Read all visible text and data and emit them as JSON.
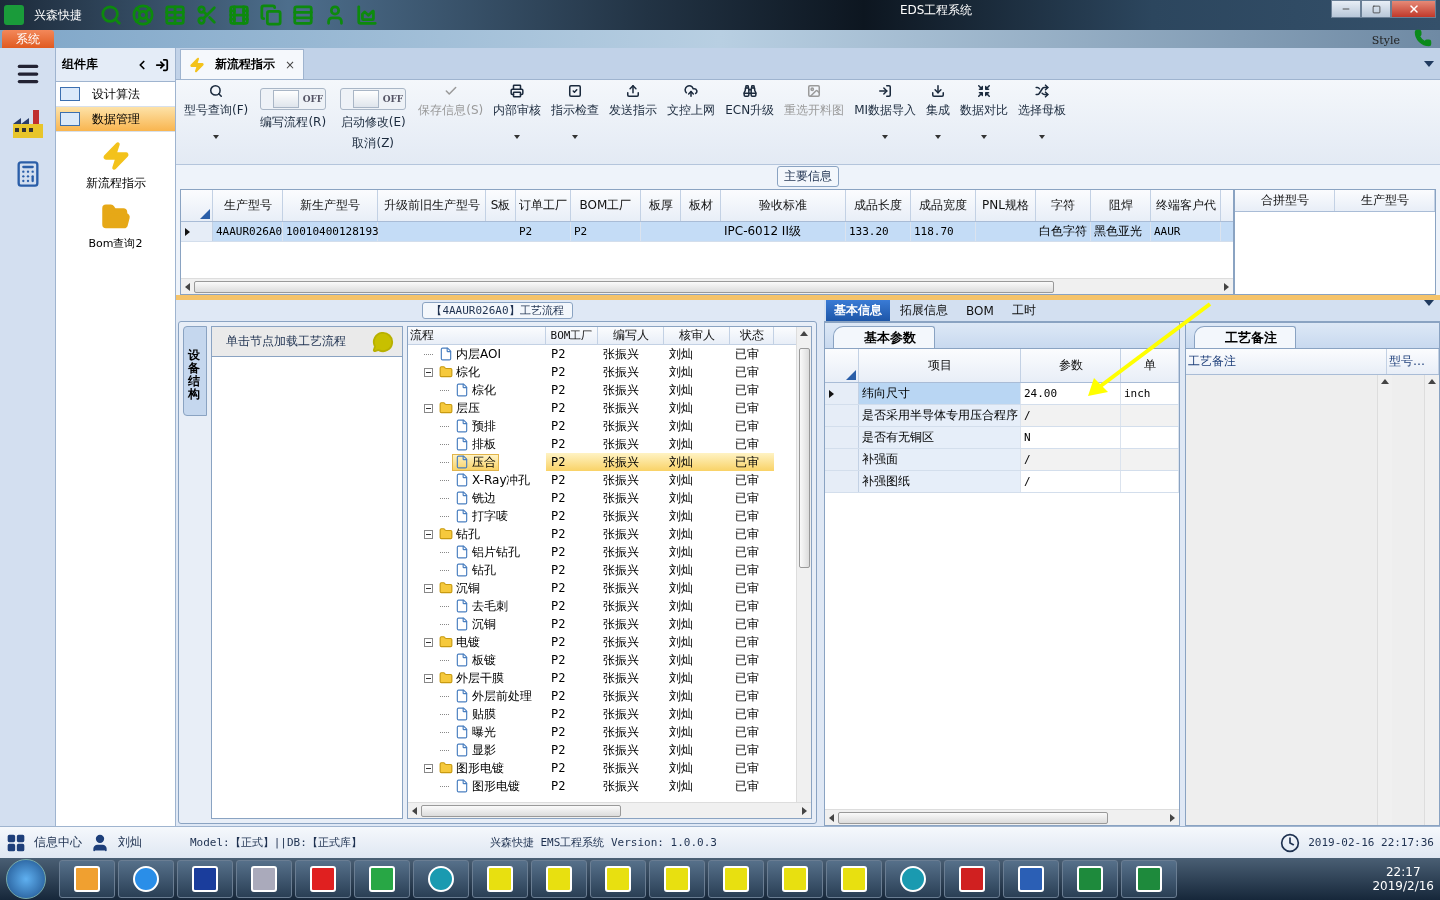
{
  "window": {
    "title": "EDS工程系统",
    "app_name": "兴森快捷"
  },
  "ribbon": {
    "tab": "系统",
    "style_menu": "Style"
  },
  "sidebar": {
    "title": "组件库",
    "items": [
      {
        "label": "设计算法",
        "selected": false
      },
      {
        "label": "数据管理",
        "selected": true
      }
    ],
    "tiles": [
      {
        "label": "新流程指示"
      },
      {
        "label": "Bom查询2"
      }
    ]
  },
  "document_tab": {
    "label": "新流程指示",
    "close": "×"
  },
  "toolbar": [
    {
      "kind": "button",
      "label": "型号查询(F)",
      "disabled": false,
      "dropdown": true
    },
    {
      "kind": "toggle",
      "label": "编写流程(R)",
      "on": false,
      "state_text": "OFF"
    },
    {
      "kind": "toggle",
      "label": "启动修改(E)",
      "sublabel": "取消(Z)",
      "on": false,
      "state_text": "OFF"
    },
    {
      "kind": "button",
      "label": "保存信息(S)",
      "disabled": true,
      "dropdown": false
    },
    {
      "kind": "button",
      "label": "内部审核",
      "disabled": false,
      "dropdown": true
    },
    {
      "kind": "button",
      "label": "指示检查",
      "disabled": false,
      "dropdown": true
    },
    {
      "kind": "button",
      "label": "发送指示",
      "disabled": false,
      "dropdown": false
    },
    {
      "kind": "button",
      "label": "文控上网",
      "disabled": false,
      "dropdown": false
    },
    {
      "kind": "button",
      "label": "ECN升级",
      "disabled": false,
      "dropdown": false
    },
    {
      "kind": "button",
      "label": "重选开料图",
      "disabled": true,
      "dropdown": false
    },
    {
      "kind": "button",
      "label": "MI数据导入",
      "disabled": false,
      "dropdown": true
    },
    {
      "kind": "button",
      "label": "集成",
      "disabled": false,
      "dropdown": true
    },
    {
      "kind": "button",
      "label": "数据对比",
      "disabled": false,
      "dropdown": true
    },
    {
      "kind": "button",
      "label": "选择母板",
      "disabled": false,
      "dropdown": true
    }
  ],
  "main_info": {
    "title": "主要信息",
    "columns": [
      "生产型号",
      "新生产型号",
      "升级前旧生产型号",
      "S板",
      "订单工厂",
      "BOM工厂",
      "板厚",
      "板材",
      "验收标准",
      "成品长度",
      "成品宽度",
      "PNL规格",
      "字符",
      "阻焊",
      "终端客户代"
    ],
    "rows": [
      {
        "selected": true,
        "cells": [
          "4AAUR026A0",
          "10010400128193",
          null,
          null,
          "P2",
          "P2",
          null,
          null,
          "IPC-6012 II级",
          "133.20",
          "118.70",
          null,
          "白色字符",
          "黑色亚光",
          "AAUR"
        ]
      }
    ],
    "side_columns": [
      "合拼型号",
      "生产型号"
    ]
  },
  "process": {
    "title": "【4AAUR026A0】工艺流程",
    "side_tab": "设备结构",
    "hint": "单击节点加载工艺流程",
    "columns": [
      "流程",
      "BOM工厂",
      "编写人",
      "核审人",
      "状态"
    ],
    "tree": [
      {
        "label": "内层AOI",
        "kind": "file",
        "selected": false,
        "bom": "P2",
        "writer": "张振兴",
        "reviewer": "刘灿",
        "status": "已审"
      },
      {
        "label": "棕化",
        "kind": "folder",
        "expanded": true,
        "selected": false,
        "bom": "P2",
        "writer": "张振兴",
        "reviewer": "刘灿",
        "status": "已审",
        "children": [
          {
            "label": "棕化",
            "kind": "file",
            "selected": false,
            "bom": "P2",
            "writer": "张振兴",
            "reviewer": "刘灿",
            "status": "已审"
          }
        ]
      },
      {
        "label": "层压",
        "kind": "folder",
        "expanded": true,
        "selected": false,
        "bom": "P2",
        "writer": "张振兴",
        "reviewer": "刘灿",
        "status": "已审",
        "children": [
          {
            "label": "预排",
            "kind": "file",
            "selected": false,
            "bom": "P2",
            "writer": "张振兴",
            "reviewer": "刘灿",
            "status": "已审"
          },
          {
            "label": "排板",
            "kind": "file",
            "selected": false,
            "bom": "P2",
            "writer": "张振兴",
            "reviewer": "刘灿",
            "status": "已审"
          },
          {
            "label": "压合",
            "kind": "file",
            "selected": true,
            "bom": "P2",
            "writer": "张振兴",
            "reviewer": "刘灿",
            "status": "已审"
          },
          {
            "label": "X-Ray冲孔",
            "kind": "file",
            "selected": false,
            "bom": "P2",
            "writer": "张振兴",
            "reviewer": "刘灿",
            "status": "已审"
          },
          {
            "label": "铣边",
            "kind": "file",
            "selected": false,
            "bom": "P2",
            "writer": "张振兴",
            "reviewer": "刘灿",
            "status": "已审"
          },
          {
            "label": "打字唛",
            "kind": "file",
            "selected": false,
            "bom": "P2",
            "writer": "张振兴",
            "reviewer": "刘灿",
            "status": "已审"
          }
        ]
      },
      {
        "label": "钻孔",
        "kind": "folder",
        "expanded": true,
        "selected": false,
        "bom": "P2",
        "writer": "张振兴",
        "reviewer": "刘灿",
        "status": "已审",
        "children": [
          {
            "label": "铝片钻孔",
            "kind": "file",
            "selected": false,
            "bom": "P2",
            "writer": "张振兴",
            "reviewer": "刘灿",
            "status": "已审"
          },
          {
            "label": "钻孔",
            "kind": "file",
            "selected": false,
            "bom": "P2",
            "writer": "张振兴",
            "reviewer": "刘灿",
            "status": "已审"
          }
        ]
      },
      {
        "label": "沉铜",
        "kind": "folder",
        "expanded": true,
        "selected": false,
        "bom": "P2",
        "writer": "张振兴",
        "reviewer": "刘灿",
        "status": "已审",
        "children": [
          {
            "label": "去毛刺",
            "kind": "file",
            "selected": false,
            "bom": "P2",
            "writer": "张振兴",
            "reviewer": "刘灿",
            "status": "已审"
          },
          {
            "label": "沉铜",
            "kind": "file",
            "selected": false,
            "bom": "P2",
            "writer": "张振兴",
            "reviewer": "刘灿",
            "status": "已审"
          }
        ]
      },
      {
        "label": "电镀",
        "kind": "folder",
        "expanded": true,
        "selected": false,
        "bom": "P2",
        "writer": "张振兴",
        "reviewer": "刘灿",
        "status": "已审",
        "children": [
          {
            "label": "板镀",
            "kind": "file",
            "selected": false,
            "bom": "P2",
            "writer": "张振兴",
            "reviewer": "刘灿",
            "status": "已审"
          }
        ]
      },
      {
        "label": "外层干膜",
        "kind": "folder",
        "expanded": true,
        "selected": false,
        "bom": "P2",
        "writer": "张振兴",
        "reviewer": "刘灿",
        "status": "已审",
        "children": [
          {
            "label": "外层前处理",
            "kind": "file",
            "selected": false,
            "bom": "P2",
            "writer": "张振兴",
            "reviewer": "刘灿",
            "status": "已审"
          },
          {
            "label": "贴膜",
            "kind": "file",
            "selected": false,
            "bom": "P2",
            "writer": "张振兴",
            "reviewer": "刘灿",
            "status": "已审"
          },
          {
            "label": "曝光",
            "kind": "file",
            "selected": false,
            "bom": "P2",
            "writer": "张振兴",
            "reviewer": "刘灿",
            "status": "已审"
          },
          {
            "label": "显影",
            "kind": "file",
            "selected": false,
            "bom": "P2",
            "writer": "张振兴",
            "reviewer": "刘灿",
            "status": "已审"
          }
        ]
      },
      {
        "label": "图形电镀",
        "kind": "folder",
        "expanded": true,
        "selected": false,
        "bom": "P2",
        "writer": "张振兴",
        "reviewer": "刘灿",
        "status": "已审",
        "children": [
          {
            "label": "图形电镀",
            "kind": "file",
            "selected": false,
            "bom": "P2",
            "writer": "张振兴",
            "reviewer": "刘灿",
            "status": "已审"
          }
        ]
      }
    ]
  },
  "details": {
    "tabs": [
      {
        "label": "基本信息",
        "selected": true
      },
      {
        "label": "拓展信息",
        "selected": false
      },
      {
        "label": "BOM",
        "selected": false
      },
      {
        "label": "工时",
        "selected": false
      }
    ],
    "params": {
      "tab": "基本参数",
      "columns": [
        "项目",
        "参数",
        "单"
      ],
      "rows": [
        {
          "item": "纬向尺寸",
          "value": "24.00",
          "unit": "inch",
          "selected": true
        },
        {
          "item": "是否采用半导体专用压合程序",
          "value": "/",
          "selected": false
        },
        {
          "item": "是否有无铜区",
          "value": "N",
          "selected": false
        },
        {
          "item": "补强面",
          "value": "/",
          "selected": false
        },
        {
          "item": "补强图纸",
          "value": "/",
          "selected": false
        }
      ]
    },
    "notes": {
      "tab": "工艺备注",
      "columns": [
        "工艺备注",
        "型号…"
      ]
    }
  },
  "status_bar": {
    "info_center": "信息中心",
    "user": "刘灿",
    "model": "Model:【正式】||DB:【正式库】",
    "version": "兴森快捷 EMS工程系统 Version: 1.0.0.3",
    "datetime": "2019-02-16 22:17:36"
  },
  "taskbar": {
    "time": "22:17",
    "date": "2019/2/16"
  }
}
